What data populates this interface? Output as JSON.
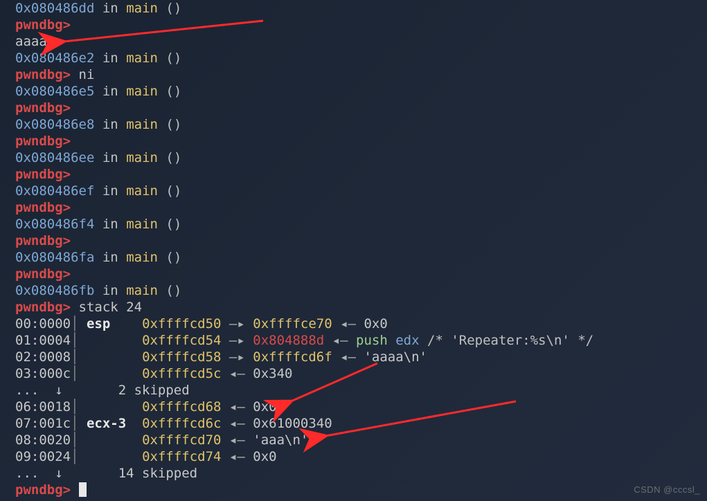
{
  "session": [
    {
      "type": "addr_in_fn",
      "addr": "0x080486dd",
      "fn": "main"
    },
    {
      "type": "prompt",
      "cmd": ""
    },
    {
      "type": "text",
      "text": "aaaa"
    },
    {
      "type": "addr_in_fn",
      "addr": "0x080486e2",
      "fn": "main"
    },
    {
      "type": "prompt",
      "cmd": "ni"
    },
    {
      "type": "addr_in_fn",
      "addr": "0x080486e5",
      "fn": "main"
    },
    {
      "type": "prompt",
      "cmd": ""
    },
    {
      "type": "addr_in_fn",
      "addr": "0x080486e8",
      "fn": "main"
    },
    {
      "type": "prompt",
      "cmd": ""
    },
    {
      "type": "addr_in_fn",
      "addr": "0x080486ee",
      "fn": "main"
    },
    {
      "type": "prompt",
      "cmd": ""
    },
    {
      "type": "addr_in_fn",
      "addr": "0x080486ef",
      "fn": "main"
    },
    {
      "type": "prompt",
      "cmd": ""
    },
    {
      "type": "addr_in_fn",
      "addr": "0x080486f4",
      "fn": "main"
    },
    {
      "type": "prompt",
      "cmd": ""
    },
    {
      "type": "addr_in_fn",
      "addr": "0x080486fa",
      "fn": "main"
    },
    {
      "type": "prompt",
      "cmd": ""
    },
    {
      "type": "addr_in_fn",
      "addr": "0x080486fb",
      "fn": "main"
    },
    {
      "type": "prompt",
      "cmd": "stack 24"
    }
  ],
  "stack": [
    {
      "idx": "00",
      "off": "0000",
      "reg": "esp  ",
      "addr": "0xffffcd50",
      "arrow": "—▸",
      "r1": "0xffffce70",
      "a2": "◂—",
      "r2": "0x0",
      "cls1": "ptr"
    },
    {
      "idx": "01",
      "off": "0004",
      "reg": "     ",
      "addr": "0xffffcd54",
      "arrow": "—▸",
      "r1": "0x804888d",
      "a2": "◂—",
      "r2asm": true,
      "cls1": "red"
    },
    {
      "idx": "02",
      "off": "0008",
      "reg": "     ",
      "addr": "0xffffcd58",
      "arrow": "—▸",
      "r1": "0xffffcd6f",
      "a2": "◂—",
      "r2": "'aaaa\\n'",
      "cls1": "ptr"
    },
    {
      "idx": "03",
      "off": "000c",
      "reg": "     ",
      "addr": "0xffffcd5c",
      "arrow": "◂—",
      "r1": "0x340"
    },
    {
      "skip": "2 skipped"
    },
    {
      "idx": "06",
      "off": "0018",
      "reg": "     ",
      "addr": "0xffffcd68",
      "arrow": "◂—",
      "r1": "0x0"
    },
    {
      "idx": "07",
      "off": "001c",
      "reg": "ecx-3",
      "addr": "0xffffcd6c",
      "arrow": "◂—",
      "r1": "0x61000340"
    },
    {
      "idx": "08",
      "off": "0020",
      "reg": "     ",
      "addr": "0xffffcd70",
      "arrow": "◂—",
      "r1": "'aaa\\n'"
    },
    {
      "idx": "09",
      "off": "0024",
      "reg": "     ",
      "addr": "0xffffcd74",
      "arrow": "◂—",
      "r1": "0x0"
    },
    {
      "skip": "14 skipped"
    }
  ],
  "asm": {
    "op": "push",
    "reg": "edx",
    "comment": "/* 'Repeater:%s\\n' */"
  },
  "prompt_text": "pwndbg>",
  "in_text": "in",
  "paren_open": "(",
  "paren_close": ")",
  "skip_prefix": "...  ↓       ",
  "watermark": "CSDN @cccsl_"
}
